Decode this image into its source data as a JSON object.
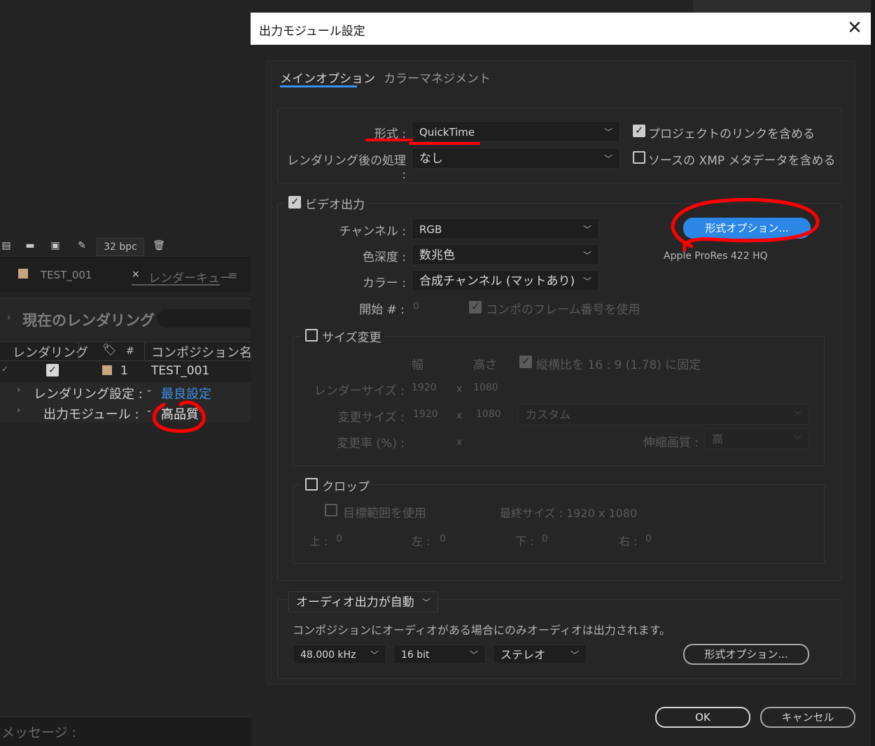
{
  "background_app": {
    "toolbar": {
      "icons": [
        "panel-icon",
        "folder-icon",
        "film-icon",
        "brush-icon",
        "trash-icon"
      ],
      "bpc_label": "32 bpc"
    },
    "tabs": [
      {
        "label": "TEST_001",
        "swatch_color": "#c7a57e"
      },
      {
        "close": "×",
        "label": "レンダーキュー",
        "menu": "≡"
      }
    ],
    "current_render": {
      "chevron": "›",
      "label": "現在のレンダリング"
    },
    "table": {
      "headers": {
        "render": "レンダリング",
        "tag": "🏷",
        "num": "#",
        "comp": "コンポジション名"
      },
      "row": {
        "tick": "✓",
        "check": "✓",
        "num": "1",
        "name": "TEST_001"
      },
      "render_settings": {
        "chevron": "›",
        "label": "レンダリング設定 :",
        "dropdown": "⌄",
        "value": "最良設定"
      },
      "output_module": {
        "chevron": "›",
        "label": "出力モジュール :",
        "dropdown": "⌄",
        "value": "高品質"
      }
    },
    "message_label": "メッセージ :"
  },
  "dialog": {
    "title": "出力モジュール設定",
    "close": "✕",
    "tabs": {
      "main": "メインオプション",
      "color": "カラーマネジメント"
    },
    "format_label": "形式 :",
    "format_value": "QuickTime",
    "post_render_label": "レンダリング後の処理 :",
    "post_render_value": "なし",
    "include_project_link": "プロジェクトのリンクを含める",
    "include_xmp": "ソースの XMP メタデータを含める",
    "video_output": {
      "label": "ビデオ出力",
      "channel_label": "チャンネル :",
      "channel_value": "RGB",
      "depth_label": "色深度 :",
      "depth_value": "数兆色",
      "color_label": "カラー :",
      "color_value": "合成チャンネル (マットあり)",
      "start_label": "開始 # :",
      "start_value": "0",
      "use_comp_frame": "コンポのフレーム番号を使用",
      "format_options_button": "形式オプション...",
      "codec_label": "Apple ProRes 422 HQ"
    },
    "resize": {
      "label": "サイズ変更",
      "width_header": "幅",
      "height_header": "高さ",
      "lock_aspect": "縦横比を 16 : 9 (1.78) に固定",
      "render_size_label": "レンダーサイズ :",
      "render_w": "1920",
      "render_h": "1080",
      "resize_to_label": "変更サイズ :",
      "resize_w": "1920",
      "resize_h": "1080",
      "preset": "カスタム",
      "percent_label": "変更率 (%) :",
      "x": "x",
      "quality_label": "伸縮画質 :",
      "quality_value": "高"
    },
    "crop": {
      "label": "クロップ",
      "use_roi": "目標範囲を使用",
      "final_size": "最終サイズ : 1920 x 1080",
      "top_label": "上 :",
      "top_value": "0",
      "left_label": "左 :",
      "left_value": "0",
      "bottom_label": "下 :",
      "bottom_value": "0",
      "right_label": "右 :",
      "right_value": "0"
    },
    "audio": {
      "mode": "オーディオ出力が自動",
      "note": "コンポジションにオーディオがある場合にのみオーディオは出力されます。",
      "rate": "48.000 kHz",
      "bits": "16 bit",
      "channels": "ステレオ",
      "format_options_button": "形式オプション..."
    },
    "ok_button": "OK",
    "cancel_button": "キャンセル"
  },
  "colors": {
    "accent": "#2b86e6",
    "link": "#3d8fe8",
    "annotation": "#ff0000"
  }
}
